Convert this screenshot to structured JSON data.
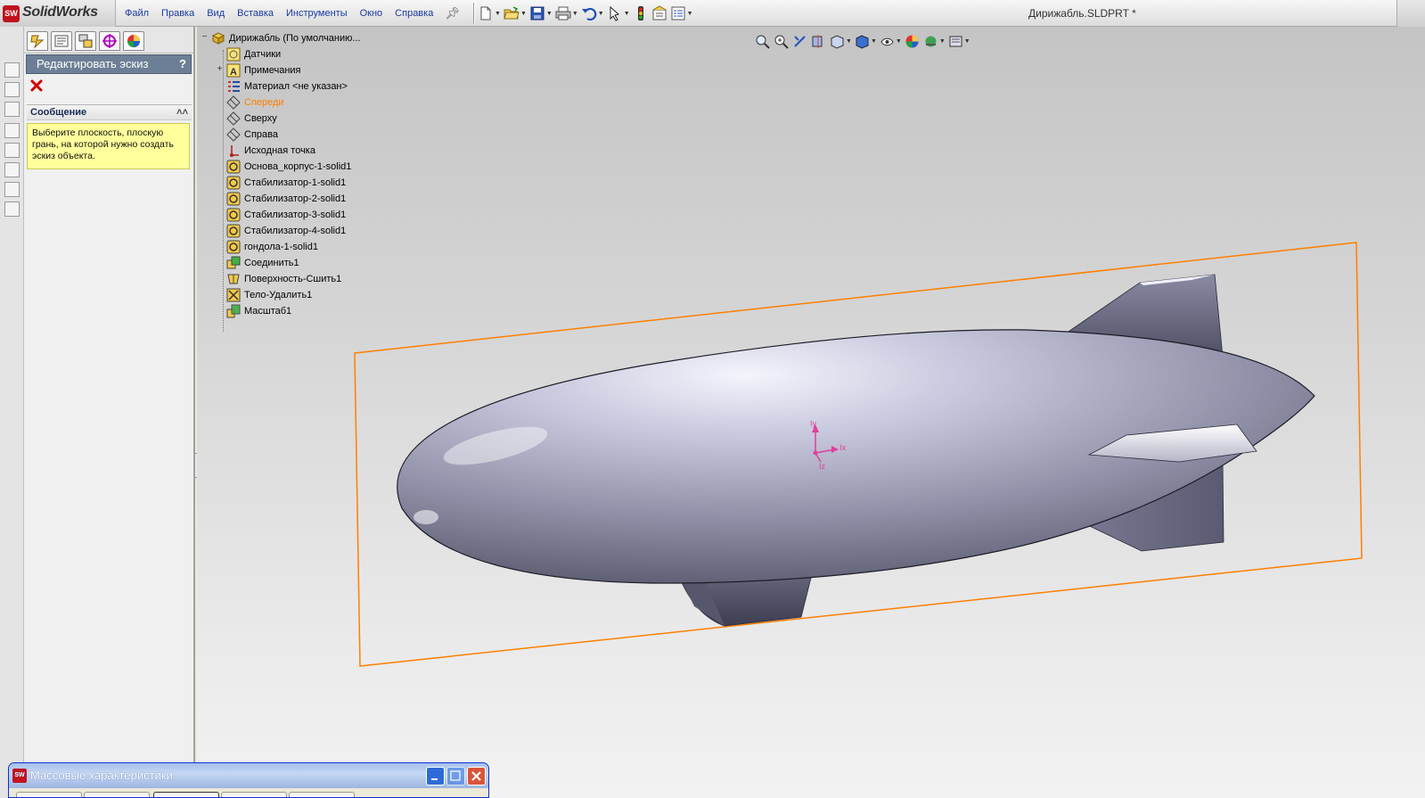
{
  "app": {
    "logo_badge": "SW",
    "logo_text": "SolidWorks"
  },
  "menu": {
    "items": [
      "Файл",
      "Правка",
      "Вид",
      "Вставка",
      "Инструменты",
      "Окно",
      "Справка"
    ]
  },
  "toolbar": {
    "icons": [
      "new-document-icon",
      "open-icon",
      "save-icon",
      "print-icon",
      "undo-icon",
      "select-icon",
      "rebuild-icon",
      "file-properties-icon",
      "options-icon"
    ]
  },
  "document": {
    "title": "Дирижабль.SLDPRT *"
  },
  "property_manager": {
    "title": "Редактировать эскиз",
    "help": "?",
    "cancel_icon": "close-icon",
    "message_header": "Сообщение",
    "message_text": "Выберите плоскость, плоскую грань, на которой нужно создать эскиз объекта."
  },
  "feature_tree": {
    "root": "Дирижабль  (По умолчанию...",
    "items": [
      {
        "label": "Датчики",
        "icon": "sensors-icon"
      },
      {
        "label": "Примечания",
        "icon": "annotations-icon"
      },
      {
        "label": "Материал <не указан>",
        "icon": "material-icon"
      },
      {
        "label": "Спереди",
        "icon": "plane-icon",
        "selected": true
      },
      {
        "label": "Сверху",
        "icon": "plane-icon"
      },
      {
        "label": "Справа",
        "icon": "plane-icon"
      },
      {
        "label": "Исходная точка",
        "icon": "origin-icon"
      },
      {
        "label": "Основа_корпус-1-solid1",
        "icon": "imported-body-icon"
      },
      {
        "label": "Стабилизатор-1-solid1",
        "icon": "imported-body-icon"
      },
      {
        "label": "Стабилизатор-2-solid1",
        "icon": "imported-body-icon"
      },
      {
        "label": "Стабилизатор-3-solid1",
        "icon": "imported-body-icon"
      },
      {
        "label": "Стабилизатор-4-solid1",
        "icon": "imported-body-icon"
      },
      {
        "label": "гондола-1-solid1",
        "icon": "imported-body-icon"
      },
      {
        "label": "Соединить1",
        "icon": "combine-icon"
      },
      {
        "label": "Поверхность-Сшить1",
        "icon": "surface-knit-icon"
      },
      {
        "label": "Тело-Удалить1",
        "icon": "delete-body-icon"
      },
      {
        "label": "Масштаб1",
        "icon": "scale-icon"
      }
    ]
  },
  "graphics": {
    "selected_plane_color": "#ff7f00",
    "body_color": "#9a9ab5",
    "triad_labels": {
      "y": "Iy",
      "x": "Ix",
      "z": "Iz"
    }
  },
  "mass_window": {
    "title": "Массовые характеристики",
    "icon_badge": "SW"
  },
  "colors": {
    "menu_text": "#1a3aa0",
    "pm_title_bg": "#6d7f96",
    "message_bg": "#ffff9c"
  }
}
